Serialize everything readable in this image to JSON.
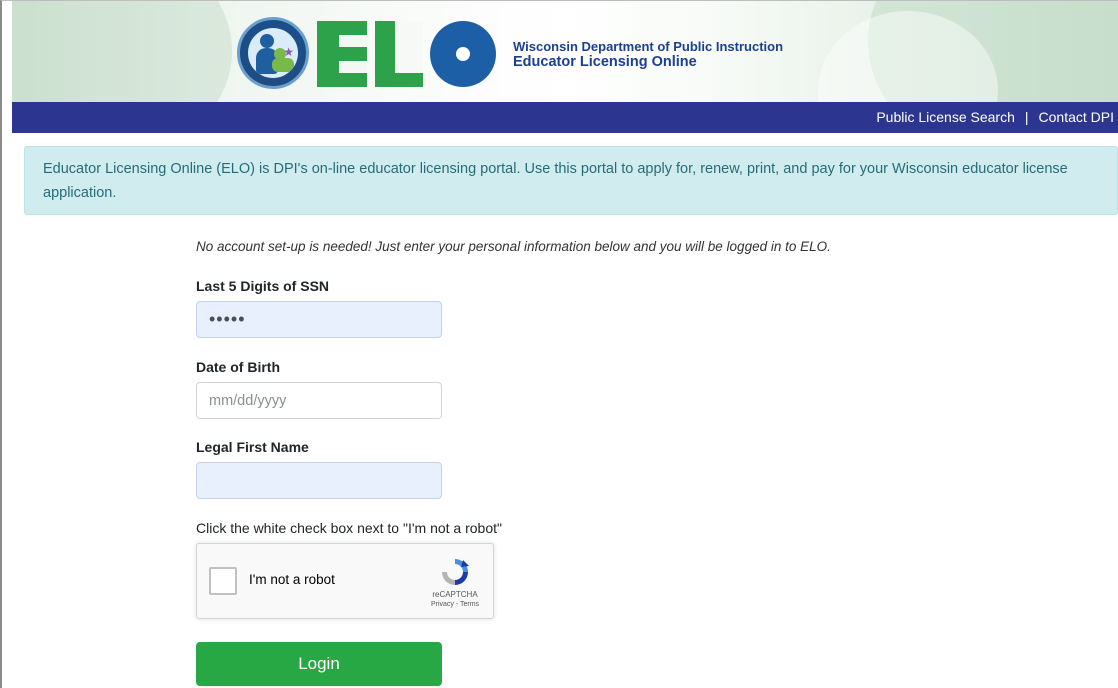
{
  "header": {
    "logo_text": "ELO",
    "agency_line1": "Wisconsin Department of Public Instruction",
    "agency_line2": "Educator Licensing Online"
  },
  "nav": {
    "links": [
      "Public License Search",
      "Contact DPI"
    ],
    "separator": "|"
  },
  "alert": {
    "text": "Educator Licensing Online (ELO) is DPI's on-line educator licensing portal. Use this portal to apply for, renew, print, and pay for your Wisconsin educator license application."
  },
  "form": {
    "intro": "No account set-up is needed! Just enter your personal information below and you will be logged in to ELO.",
    "ssn": {
      "label": "Last 5 Digits of SSN",
      "value": "•••••",
      "placeholder": ""
    },
    "dob": {
      "label": "Date of Birth",
      "value": "",
      "placeholder": "mm/dd/yyyy"
    },
    "first_name": {
      "label": "Legal First Name",
      "value": "",
      "placeholder": ""
    },
    "captcha_instruction": "Click the white check box next to \"I'm not a robot\"",
    "recaptcha": {
      "label": "I'm not a robot",
      "brand": "reCAPTCHA",
      "links": "Privacy - Terms"
    },
    "login_label": "Login"
  },
  "colors": {
    "navbar": "#2c3690",
    "alert_bg": "#d1ecef",
    "alert_text": "#246d78",
    "login_green": "#28a745",
    "autofill_bg": "#e8f0fe"
  },
  "icons": [
    "dpi-seal-icon",
    "recaptcha-logo-icon"
  ]
}
